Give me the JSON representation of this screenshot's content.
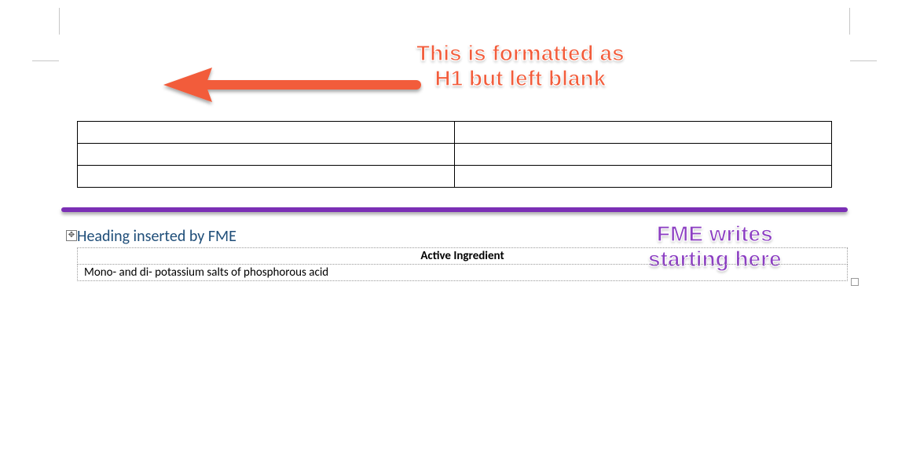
{
  "annotations": {
    "red_line1": "This is formatted as",
    "red_line2": "H1 but left blank",
    "purple_line1": "FME writes",
    "purple_line2": "starting here"
  },
  "colors": {
    "annotation_red": "#f25c3b",
    "annotation_purple": "#8c3fc2",
    "divider_purple": "#7b2fb5",
    "heading_blue": "#1f4e79"
  },
  "document": {
    "blank_table": {
      "rows": 3,
      "cols": 2
    },
    "inserted_heading": "Heading inserted by FME",
    "inserted_table": {
      "header": "Active Ingredient",
      "rows": [
        "Mono- and di- potassium salts of phosphorous acid"
      ]
    }
  }
}
